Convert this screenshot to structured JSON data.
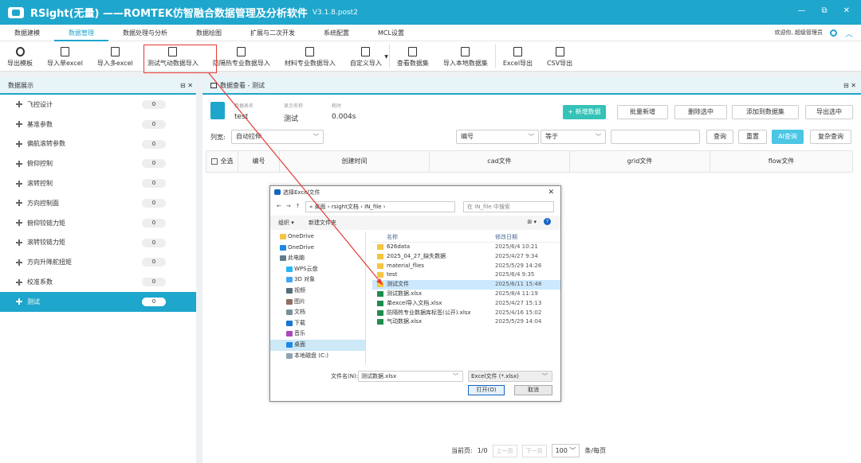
{
  "app": {
    "title": "RSight(无量) ——ROMTEK仿智融合数据管理及分析软件",
    "version": "V3.1.8.post2",
    "minimize": "—",
    "restore": "⧉",
    "close": "✕"
  },
  "menu": {
    "items": [
      "数据建模",
      "数据管理",
      "数据处理与分析",
      "数据绘图",
      "扩展与二次开发",
      "系统配置",
      "MCL设置"
    ],
    "welcome": "欢迎你, 超级管理员"
  },
  "toolbar": {
    "items": [
      "导出模板",
      "导入单excel",
      "导入多excel",
      "测试气动数据导入",
      "防隔热专业数据导入",
      "材料专业数据导入",
      "自定义导入",
      "查看数据集",
      "导入本地数据集",
      "Excel导出",
      "CSV导出"
    ]
  },
  "left": {
    "header": "数据展示",
    "controls": "⊟ ✕",
    "items": [
      {
        "label": "飞控设计",
        "count": "0"
      },
      {
        "label": "基准参数",
        "count": "0"
      },
      {
        "label": "偏航滚转参数",
        "count": "0"
      },
      {
        "label": "俯仰控制",
        "count": "0"
      },
      {
        "label": "滚转控制",
        "count": "0"
      },
      {
        "label": "方向控制面",
        "count": "0"
      },
      {
        "label": "俯仰铰链力矩",
        "count": "0"
      },
      {
        "label": "滚转铰链力矩",
        "count": "0"
      },
      {
        "label": "方向升降舵扭矩",
        "count": "0"
      },
      {
        "label": "校准系数",
        "count": "0"
      },
      {
        "label": "测试",
        "count": "0"
      }
    ]
  },
  "main": {
    "tab": "数据查看 - 测试",
    "tab_controls": "⊟ ✕",
    "info": {
      "table_label": "数据表名",
      "table_value": "test",
      "display_label": "显示名称",
      "display_value": "测试",
      "time_label": "耗时",
      "time_value": "0.004s"
    },
    "actions": [
      "+ 新增数据",
      "批量新增",
      "删除选中",
      "添加到数据集",
      "导出选中"
    ],
    "filter": {
      "label": "列宽:",
      "width_mode": "自动拉伸",
      "field": "编号",
      "op": "等于",
      "query": "查询",
      "reset": "重置",
      "ai": "AI查询",
      "complex": "复杂查询"
    },
    "columns": [
      "全选",
      "编号",
      "创建时间",
      "cad文件",
      "grid文件",
      "flow文件"
    ],
    "pager": {
      "current": "当前页:",
      "page": "1/0",
      "prev": "上一页",
      "next": "下一页",
      "size": "100",
      "unit": "条/每页"
    }
  },
  "dialog": {
    "title": "选择Excel文件",
    "path": "« 桌面 › rsight文档 › IN_file ›",
    "search": "在 IN_file 中搜索",
    "organize": "组织 ▾",
    "new_folder": "新建文件夹",
    "nav": [
      {
        "label": "OneDrive",
        "sub": false
      },
      {
        "label": "OneDrive",
        "sub": false
      },
      {
        "label": "此电脑",
        "sub": false
      },
      {
        "label": "WPS云盘",
        "sub": true
      },
      {
        "label": "3D 对象",
        "sub": true
      },
      {
        "label": "视频",
        "sub": true
      },
      {
        "label": "图片",
        "sub": true
      },
      {
        "label": "文档",
        "sub": true
      },
      {
        "label": "下载",
        "sub": true
      },
      {
        "label": "音乐",
        "sub": true
      },
      {
        "label": "桌面",
        "sub": true
      },
      {
        "label": "本地磁盘 (C:)",
        "sub": true
      }
    ],
    "col_name": "名称",
    "col_date": "修改日期",
    "files": [
      {
        "name": "626data",
        "date": "2025/6/4 10:21",
        "type": "folder"
      },
      {
        "name": "2025_04_27_缺失数据",
        "date": "2025/4/27 9:34",
        "type": "folder"
      },
      {
        "name": "material_flies",
        "date": "2025/5/29 14:26",
        "type": "folder"
      },
      {
        "name": "test",
        "date": "2025/6/4 9:35",
        "type": "folder"
      },
      {
        "name": "测试文件",
        "date": "2025/6/11 15:48",
        "type": "folder"
      },
      {
        "name": "测试数据.xlsx",
        "date": "2025/8/4 11:19",
        "type": "xlsx"
      },
      {
        "name": "单excel导入文档.xlsx",
        "date": "2025/4/27 15:13",
        "type": "xlsx"
      },
      {
        "name": "防隔热专业数据库标签(公开).xlsx",
        "date": "2025/4/16 15:02",
        "type": "xlsx"
      },
      {
        "name": "气动数据.xlsx",
        "date": "2025/5/29 14:04",
        "type": "xlsx"
      }
    ],
    "filename_label": "文件名(N):",
    "filename": "测试数据.xlsx",
    "filetype": "Excel文件 (*.xlsx)",
    "open": "打开(O)",
    "cancel": "取消"
  },
  "colors": {
    "accent": "#1ea6cd",
    "teal": "#35c2b8",
    "highlight": "#e53935"
  }
}
